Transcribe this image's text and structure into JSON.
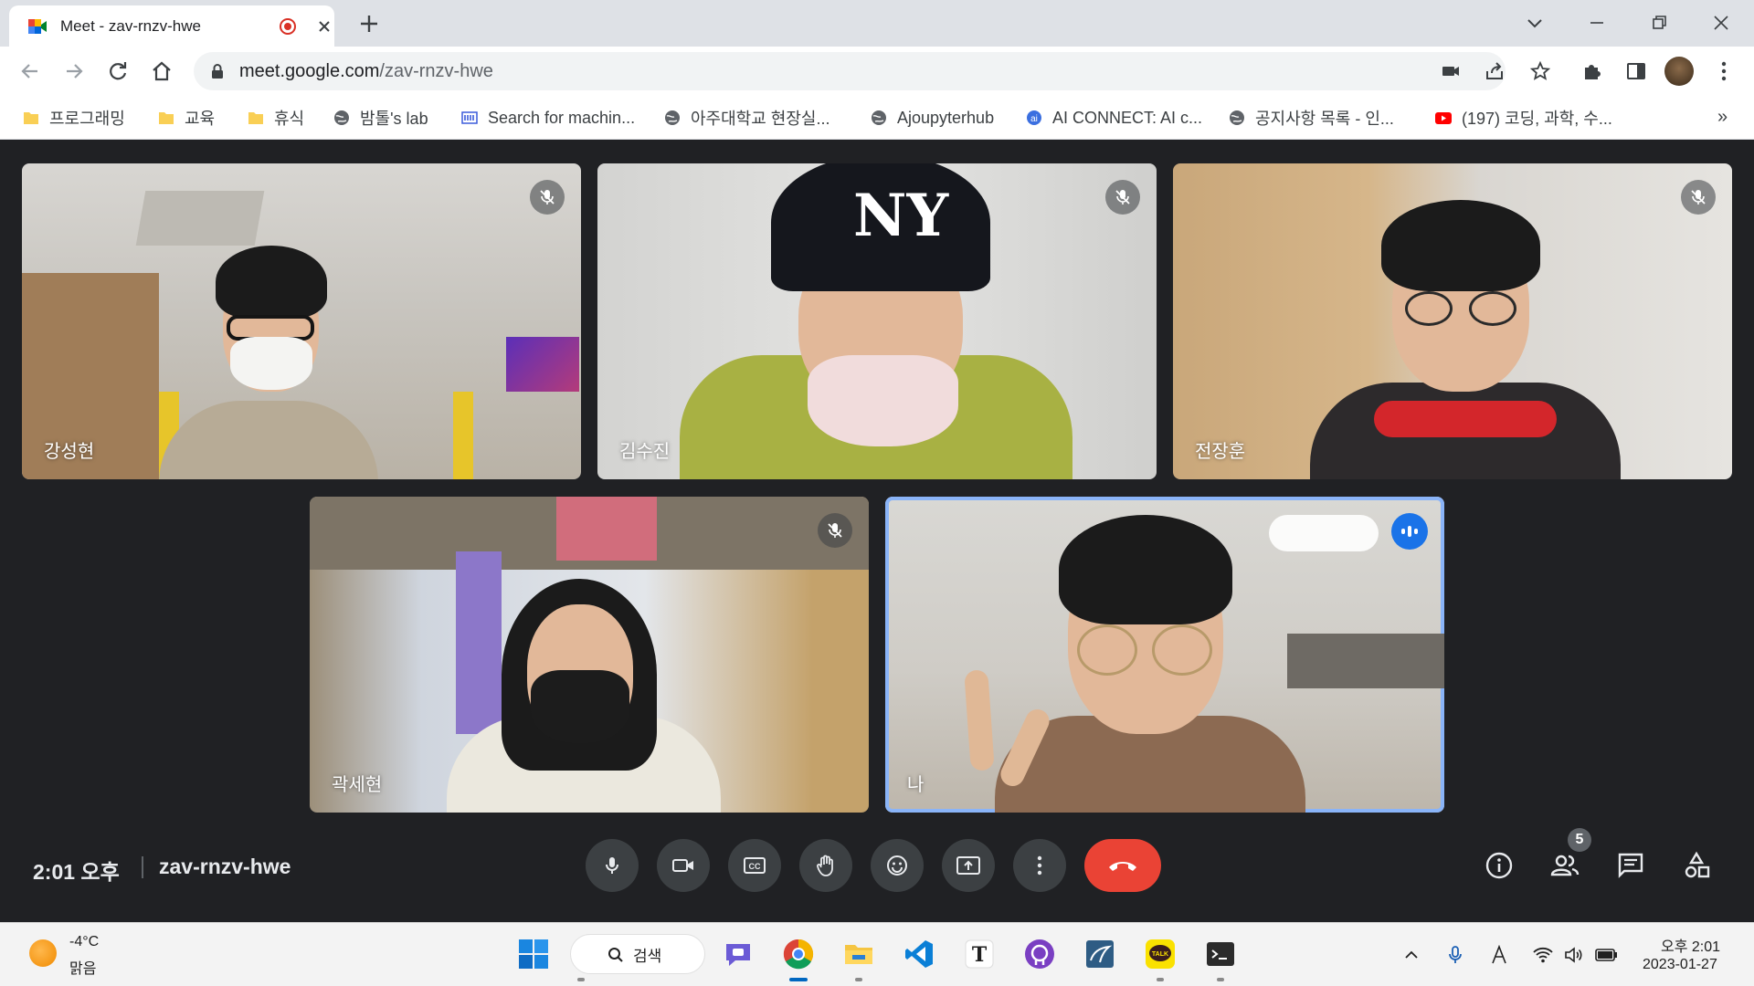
{
  "browser": {
    "tab": {
      "title": "Meet - zav-rnzv-hwe"
    },
    "url": {
      "host": "meet.google.com",
      "path": "/zav-rnzv-hwe"
    },
    "bookmarks": [
      {
        "label": "프로그래밍",
        "icon": "folder-icon"
      },
      {
        "label": "교육",
        "icon": "folder-icon"
      },
      {
        "label": "휴식",
        "icon": "folder-icon"
      },
      {
        "label": "밤톨's lab",
        "icon": "globe-icon"
      },
      {
        "label": "Search for machin...",
        "icon": "site-icon"
      },
      {
        "label": "아주대학교 현장실...",
        "icon": "globe-icon"
      },
      {
        "label": "Ajoupyterhub",
        "icon": "globe-icon"
      },
      {
        "label": "AI CONNECT: AI c...",
        "icon": "ai-icon"
      },
      {
        "label": "공지사항 목록 - 인...",
        "icon": "globe-icon"
      },
      {
        "label": "(197) 코딩, 과학, 수...",
        "icon": "youtube-icon"
      }
    ],
    "bookmarks_more": "»"
  },
  "meet": {
    "participants": [
      {
        "name": "강성현",
        "status": "muted"
      },
      {
        "name": "김수진",
        "status": "muted"
      },
      {
        "name": "전장훈",
        "status": "muted"
      },
      {
        "name": "곽세현",
        "status": "muted"
      },
      {
        "name": "나",
        "status": "speaking"
      }
    ],
    "time": "2:01 오후",
    "meeting_code": "zav-rnzv-hwe",
    "participant_count": "5",
    "colors": {
      "hangup": "#ea4335",
      "active_border": "#8ab4f8",
      "speaking": "#1a73e8"
    }
  },
  "taskbar": {
    "weather": {
      "temp": "-4°C",
      "condition": "맑음"
    },
    "search_label": "검색",
    "clock": {
      "time": "오후 2:01",
      "date": "2023-01-27"
    }
  }
}
